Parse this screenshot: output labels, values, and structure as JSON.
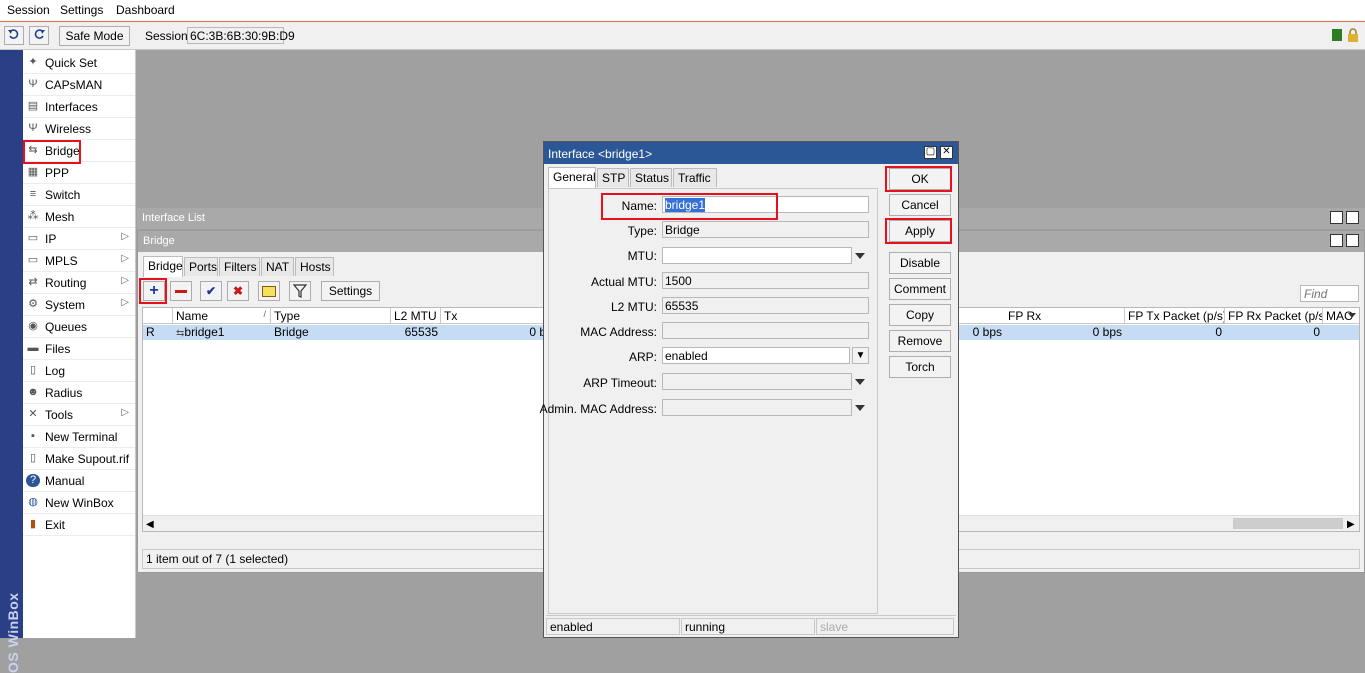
{
  "menubar": {
    "items": [
      "Session",
      "Settings",
      "Dashboard"
    ]
  },
  "toolbar": {
    "safe_mode": "Safe Mode",
    "session_label": "Session:",
    "session_value": "6C:3B:6B:30:9B:D9"
  },
  "brand": "OS WinBox",
  "sidebar": {
    "items": [
      {
        "label": "Quick Set",
        "icon": "wand-icon"
      },
      {
        "label": "CAPsMAN",
        "icon": "antenna-icon"
      },
      {
        "label": "Interfaces",
        "icon": "network-card-icon"
      },
      {
        "label": "Wireless",
        "icon": "antenna-icon"
      },
      {
        "label": "Bridge",
        "icon": "bridge-icon"
      },
      {
        "label": "PPP",
        "icon": "ppp-icon"
      },
      {
        "label": "Switch",
        "icon": "switch-icon"
      },
      {
        "label": "Mesh",
        "icon": "mesh-icon"
      },
      {
        "label": "IP",
        "icon": "ip-icon"
      },
      {
        "label": "MPLS",
        "icon": "mpls-icon"
      },
      {
        "label": "Routing",
        "icon": "routing-icon"
      },
      {
        "label": "System",
        "icon": "gear-icon"
      },
      {
        "label": "Queues",
        "icon": "queues-icon"
      },
      {
        "label": "Files",
        "icon": "folder-icon"
      },
      {
        "label": "Log",
        "icon": "log-icon"
      },
      {
        "label": "Radius",
        "icon": "users-icon"
      },
      {
        "label": "Tools",
        "icon": "tools-icon"
      },
      {
        "label": "New Terminal",
        "icon": "terminal-icon"
      },
      {
        "label": "Make Supout.rif",
        "icon": "document-icon"
      },
      {
        "label": "Manual",
        "icon": "help-icon"
      },
      {
        "label": "New WinBox",
        "icon": "globe-icon"
      },
      {
        "label": "Exit",
        "icon": "exit-icon"
      }
    ]
  },
  "interface_list": {
    "title": "Interface List"
  },
  "bridge_window": {
    "title": "Bridge",
    "tabs": [
      "Bridge",
      "Ports",
      "Filters",
      "NAT",
      "Hosts"
    ],
    "settings_label": "Settings",
    "find_placeholder": "Find",
    "columns": [
      "Name",
      "Type",
      "L2 MTU",
      "Tx",
      "FP Rx",
      "FP Tx Packet (p/s)",
      "FP Rx Packet (p/s)",
      "MAC"
    ],
    "row": {
      "flag": "R",
      "name": "bridge1",
      "type": "Bridge",
      "l2mtu": "65535",
      "tx": "0 b",
      "rx_tail": "0 bps",
      "fp_rx": "0 bps",
      "fp_tx_pkt": "0",
      "fp_rx_pkt": "0"
    },
    "status": "1 item out of 7 (1 selected)"
  },
  "dialog": {
    "title": "Interface <bridge1>",
    "tabs": [
      "General",
      "STP",
      "Status",
      "Traffic"
    ],
    "fields": {
      "name_label": "Name:",
      "name_value": "bridge1",
      "type_label": "Type:",
      "type_value": "Bridge",
      "mtu_label": "MTU:",
      "mtu_value": "",
      "actual_mtu_label": "Actual MTU:",
      "actual_mtu_value": "1500",
      "l2mtu_label": "L2 MTU:",
      "l2mtu_value": "65535",
      "mac_label": "MAC Address:",
      "mac_value": "",
      "arp_label": "ARP:",
      "arp_value": "enabled",
      "arp_timeout_label": "ARP Timeout:",
      "arp_timeout_value": "",
      "admin_mac_label": "Admin. MAC Address:",
      "admin_mac_value": ""
    },
    "buttons": [
      "OK",
      "Cancel",
      "Apply",
      "Disable",
      "Comment",
      "Copy",
      "Remove",
      "Torch"
    ],
    "status": [
      "enabled",
      "running",
      "slave"
    ]
  },
  "colors": {
    "highlight": "#e8101a",
    "title_bar": "#2b5797",
    "selected_row": "#c6dcf5",
    "brand_strip": "#2b3f87"
  }
}
